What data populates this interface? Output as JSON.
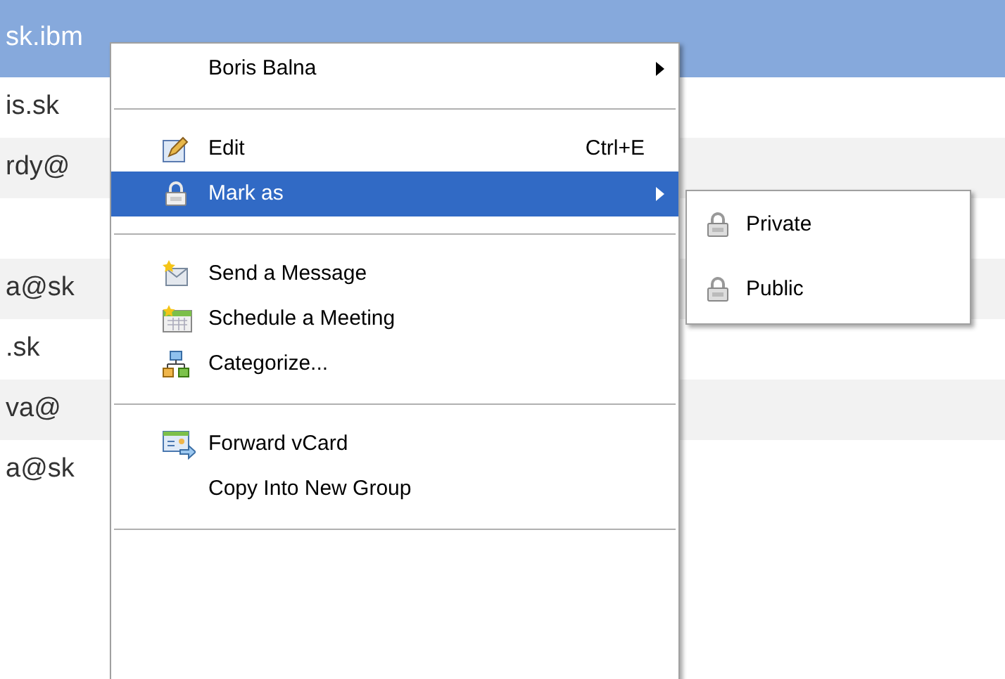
{
  "list": {
    "rows": [
      {
        "text": "sk.ibm",
        "selected": true
      },
      {
        "text": "is.sk",
        "selected": false
      },
      {
        "text": "rdy@",
        "selected": false
      },
      {
        "selected": false
      },
      {
        "text": "a@sk",
        "selected": false
      },
      {
        "text": ".sk",
        "selected": false
      },
      {
        "text": "va@",
        "selected": false
      },
      {
        "text": "a@sk",
        "selected": false
      }
    ]
  },
  "context_menu": {
    "items": [
      {
        "kind": "item",
        "label": "Boris Balna",
        "submenu": true,
        "highlighted": false
      },
      {
        "kind": "separator"
      },
      {
        "kind": "item",
        "label": "Edit",
        "shortcut": "Ctrl+E",
        "submenu": false,
        "highlighted": false
      },
      {
        "kind": "item",
        "label": "Mark as",
        "submenu": true,
        "highlighted": true
      },
      {
        "kind": "separator"
      },
      {
        "kind": "item",
        "label": "Send a Message",
        "submenu": false,
        "highlighted": false
      },
      {
        "kind": "item",
        "label": "Schedule a Meeting",
        "submenu": false,
        "highlighted": false
      },
      {
        "kind": "item",
        "label": "Categorize...",
        "submenu": false,
        "highlighted": false
      },
      {
        "kind": "separator"
      },
      {
        "kind": "item",
        "label": "Forward vCard",
        "submenu": false,
        "highlighted": false
      },
      {
        "kind": "item",
        "label": "Copy Into New Group",
        "submenu": false,
        "highlighted": false
      },
      {
        "kind": "separator"
      }
    ]
  },
  "submenu": {
    "items": [
      {
        "label": "Private"
      },
      {
        "label": "Public"
      }
    ]
  }
}
